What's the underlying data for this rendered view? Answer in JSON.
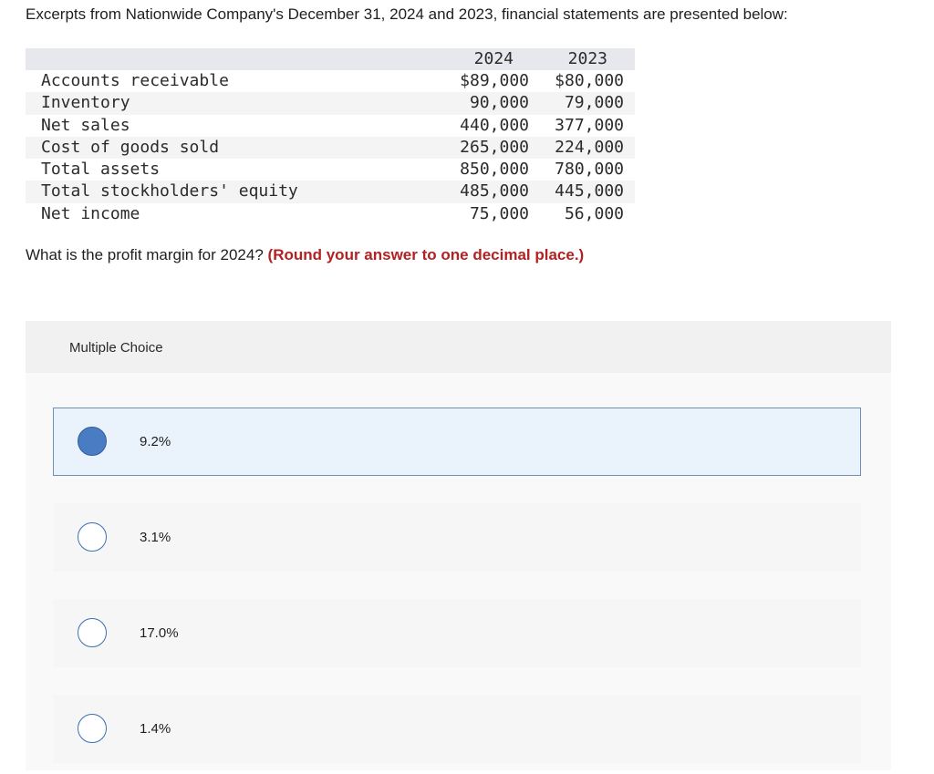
{
  "intro_text": "Excerpts from Nationwide Company's December 31, 2024 and 2023, financial statements are presented below:",
  "table": {
    "col_2024": "2024",
    "col_2023": "2023",
    "rows": [
      {
        "label": "Accounts receivable",
        "v2024": "$89,000",
        "v2023": "$80,000"
      },
      {
        "label": "Inventory",
        "v2024": "90,000",
        "v2023": "79,000"
      },
      {
        "label": "Net sales",
        "v2024": "440,000",
        "v2023": "377,000"
      },
      {
        "label": "Cost of goods sold",
        "v2024": "265,000",
        "v2023": "224,000"
      },
      {
        "label": "Total assets",
        "v2024": "850,000",
        "v2023": "780,000"
      },
      {
        "label": "Total stockholders' equity",
        "v2024": "485,000",
        "v2023": "445,000"
      },
      {
        "label": "Net income",
        "v2024": "75,000",
        "v2023": "56,000"
      }
    ]
  },
  "question": {
    "text": "What is the profit margin for 2024?",
    "hint": "(Round your answer to one decimal place.)"
  },
  "multiple_choice": {
    "title": "Multiple Choice",
    "selected_index": 0,
    "options": [
      {
        "label": "9.2%"
      },
      {
        "label": "3.1%"
      },
      {
        "label": "17.0%"
      },
      {
        "label": "1.4%"
      }
    ]
  },
  "colors": {
    "hint": "#b22222",
    "selected_bg": "#eaf2fb",
    "selected_radio": "#4a7cc4",
    "radio_border": "#3a6fb3"
  }
}
